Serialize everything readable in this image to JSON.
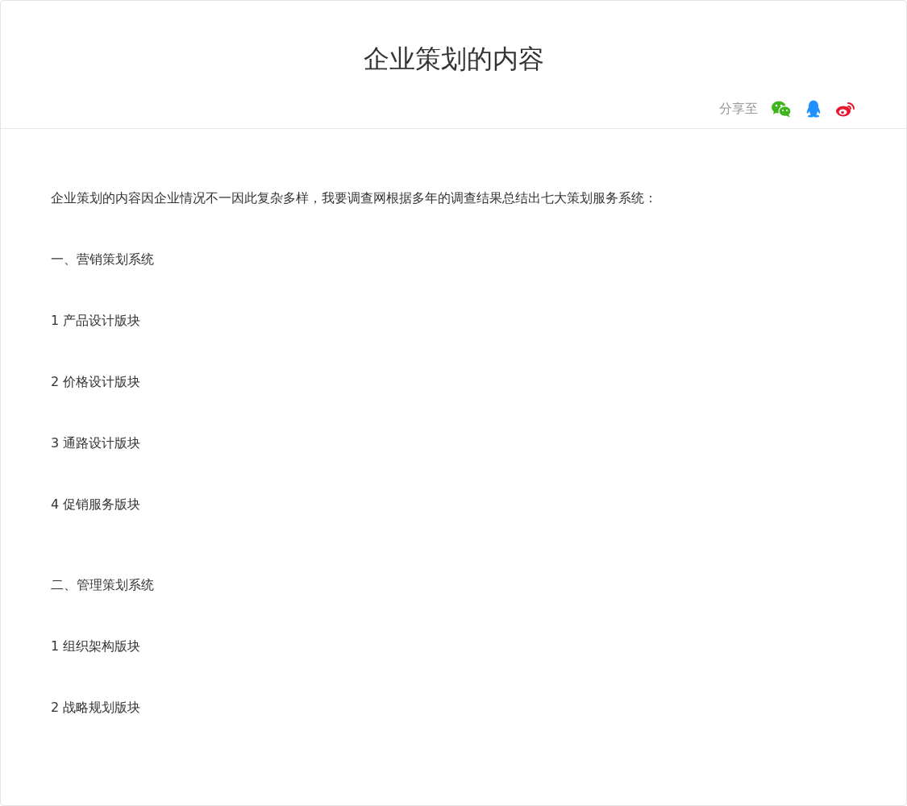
{
  "article": {
    "title": "企业策划的内容",
    "share": {
      "label": "分享至",
      "targets": [
        {
          "kind": "wechat"
        },
        {
          "kind": "qq"
        },
        {
          "kind": "weibo"
        }
      ]
    },
    "intro": "企业策划的内容因企业情况不一因此复杂多样，我要调查网根据多年的调查结果总结出七大策划服务系统：",
    "sections": [
      {
        "heading": "一、营销策划系统",
        "items": [
          "1 产品设计版块",
          "2 价格设计版块",
          "3 通路设计版块",
          "4 促销服务版块"
        ]
      },
      {
        "heading": "二、管理策划系统",
        "items": [
          "1 组织架构版块",
          "2 战略规划版块"
        ]
      }
    ]
  }
}
